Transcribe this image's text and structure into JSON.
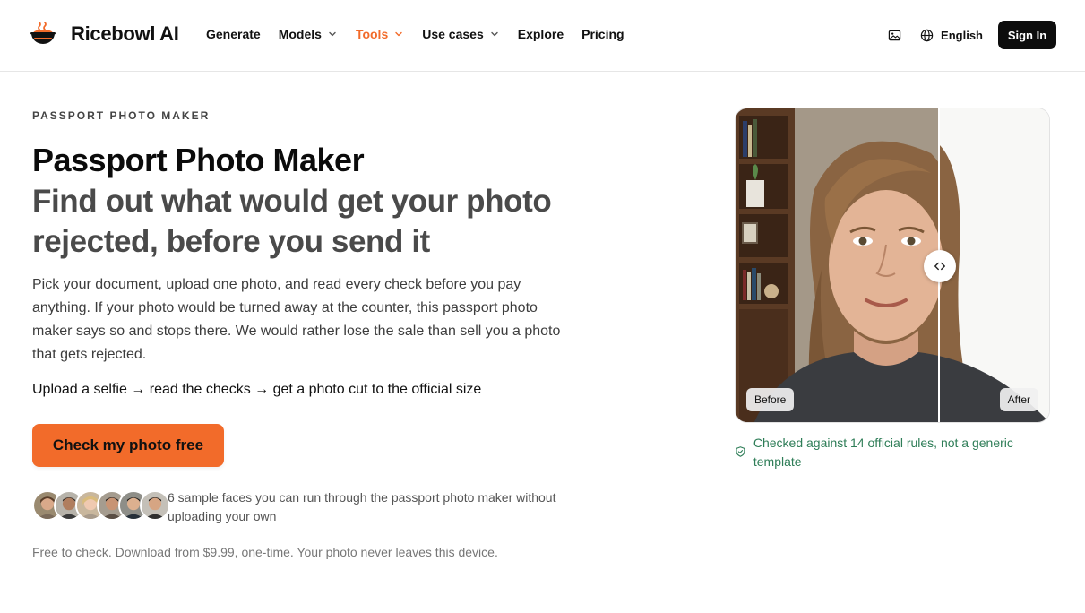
{
  "brand": {
    "name": "Ricebowl AI"
  },
  "nav": {
    "items": [
      {
        "label": "Generate",
        "dropdown": false,
        "active": false
      },
      {
        "label": "Models",
        "dropdown": true,
        "active": false
      },
      {
        "label": "Tools",
        "dropdown": true,
        "active": true
      },
      {
        "label": "Use cases",
        "dropdown": true,
        "active": false
      },
      {
        "label": "Explore",
        "dropdown": false,
        "active": false
      },
      {
        "label": "Pricing",
        "dropdown": false,
        "active": false
      }
    ]
  },
  "header_right": {
    "image_icon": "image-icon",
    "language_icon": "globe-icon",
    "language": "English",
    "sign_in": "Sign In"
  },
  "hero": {
    "eyebrow": "PASSPORT PHOTO MAKER",
    "title": "Passport Photo Maker",
    "subtitle": "Find out what would get your photo rejected, before you send it",
    "description": "Pick your document, upload one photo, and read every check before you pay anything. If your photo would be turned away at the counter, this passport photo maker says so and stops there. We would rather lose the sale than sell you a photo that gets rejected.",
    "flow": "Upload a selfie → read the checks → get a photo cut to the official size",
    "cta": "Check my photo free",
    "sample_faces_caption": "6 sample faces you can run through the passport photo maker without uploading your own",
    "fineprint": "Free to check. Download from $9.99, one-time. Your photo never leaves this device."
  },
  "compare": {
    "before_label": "Before",
    "after_label": "After",
    "handle_icon": "chevrons-left-right-icon",
    "verified_icon": "shield-check-icon",
    "verified_text": "Checked against 14 official rules, not a generic template"
  },
  "colors": {
    "accent": "#f26b2a",
    "verified": "#2e7d57",
    "dark_button": "#0d0d0d"
  }
}
